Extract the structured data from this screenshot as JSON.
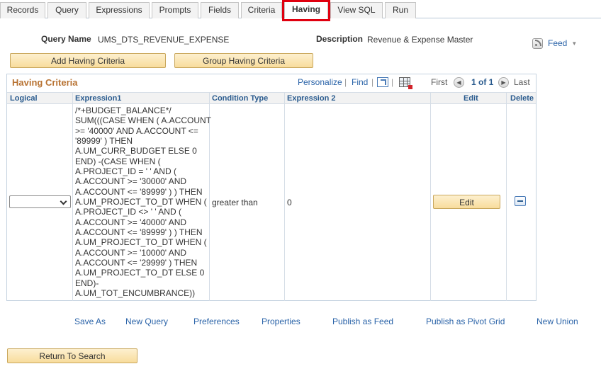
{
  "tabs": [
    {
      "label": "Records",
      "active": false
    },
    {
      "label": "Query",
      "active": false
    },
    {
      "label": "Expressions",
      "active": false
    },
    {
      "label": "Prompts",
      "active": false
    },
    {
      "label": "Fields",
      "active": false
    },
    {
      "label": "Criteria",
      "active": false
    },
    {
      "label": "Having",
      "active": true
    },
    {
      "label": "View SQL",
      "active": false
    },
    {
      "label": "Run",
      "active": false
    }
  ],
  "header": {
    "query_name_label": "Query Name",
    "query_name_value": "UMS_DTS_REVENUE_EXPENSE",
    "description_label": "Description",
    "description_value": "Revenue & Expense Master",
    "feed_label": "Feed"
  },
  "buttons": {
    "add_having": "Add Having Criteria",
    "group_having": "Group Having Criteria",
    "return_to_search": "Return To Search"
  },
  "grid": {
    "title": "Having Criteria",
    "personalize": "Personalize",
    "find": "Find",
    "first": "First",
    "page_info": "1 of 1",
    "last": "Last",
    "columns": {
      "logical": "Logical",
      "expression1": "Expression1",
      "condition_type": "Condition Type",
      "expression2": "Expression 2",
      "edit": "Edit",
      "delete": "Delete"
    },
    "rows": [
      {
        "logical": "",
        "expression1": "/*+BUDGET_BALANCE*/ SUM(((CASE WHEN ( A.ACCOUNT >= '40000' AND A.ACCOUNT <= '89999' ) THEN A.UM_CURR_BUDGET ELSE 0 END) -(CASE WHEN ( A.PROJECT_ID = ' ' AND ( A.ACCOUNT >= '30000' AND A.ACCOUNT <= '89999' ) ) THEN A.UM_PROJECT_TO_DT WHEN ( A.PROJECT_ID <> ' ' AND ( A.ACCOUNT >= '40000' AND A.ACCOUNT <= '89999' ) ) THEN A.UM_PROJECT_TO_DT WHEN ( A.ACCOUNT >= '10000' AND A.ACCOUNT <= '29999' ) THEN A.UM_PROJECT_TO_DT ELSE 0 END)-A.UM_TOT_ENCUMBRANCE))",
        "condition_type": "greater than",
        "expression2": "0",
        "edit_label": "Edit"
      }
    ]
  },
  "footer_links": [
    "Save As",
    "New Query",
    "Preferences",
    "Properties",
    "Publish as Feed",
    "Publish as Pivot Grid",
    "New Union"
  ],
  "colors": {
    "accent_link": "#2a63a8",
    "grid_title": "#b87333",
    "button_fill": "#f8dc9c",
    "tab_highlight": "#e0000f"
  }
}
